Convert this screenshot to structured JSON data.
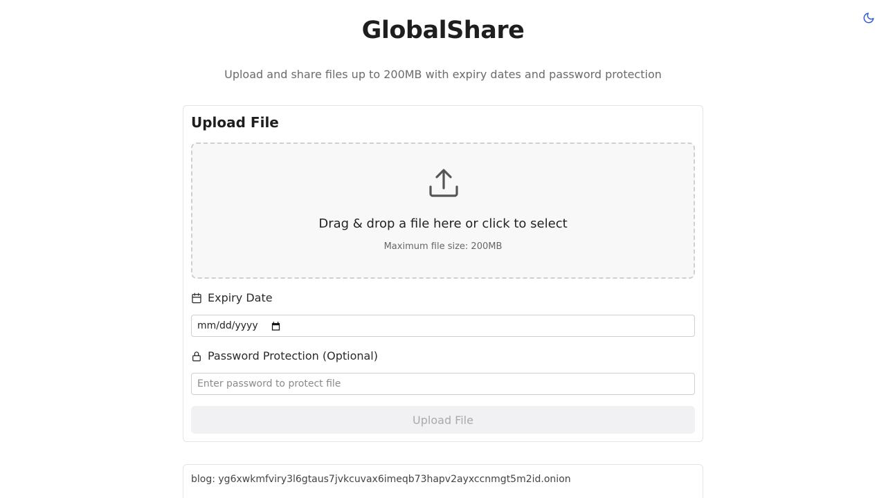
{
  "header": {
    "title": "GlobalShare",
    "subtitle": "Upload and share files up to 200MB with expiry dates and password protection",
    "theme_toggle_icon": "moon-icon"
  },
  "upload_card": {
    "title": "Upload File",
    "dropzone": {
      "icon": "upload-icon",
      "main_text": "Drag & drop a file here or click to select",
      "sub_text": "Maximum file size: 200MB"
    },
    "expiry": {
      "label": "Expiry Date",
      "icon": "calendar-icon",
      "value": "mm/dd/yyyy"
    },
    "password": {
      "label": "Password Protection (Optional)",
      "icon": "lock-icon",
      "placeholder": "Enter password to protect file",
      "value": ""
    },
    "submit_label": "Upload File"
  },
  "footer": {
    "text": "blog: yg6xwkmfviry3l6gtaus7jvkcuvax6imeqb73hapv2ayxccnmgt5m2id.onion"
  },
  "colors": {
    "title": "#1e1e1e",
    "subtitle": "#6b6b6b",
    "border": "#e3e3e3",
    "dropzone_bg": "#f8f8f8",
    "button_disabled_bg": "#f1f1f3",
    "button_disabled_text": "#a9a9ae",
    "accent_icon": "#2f5bd3"
  }
}
